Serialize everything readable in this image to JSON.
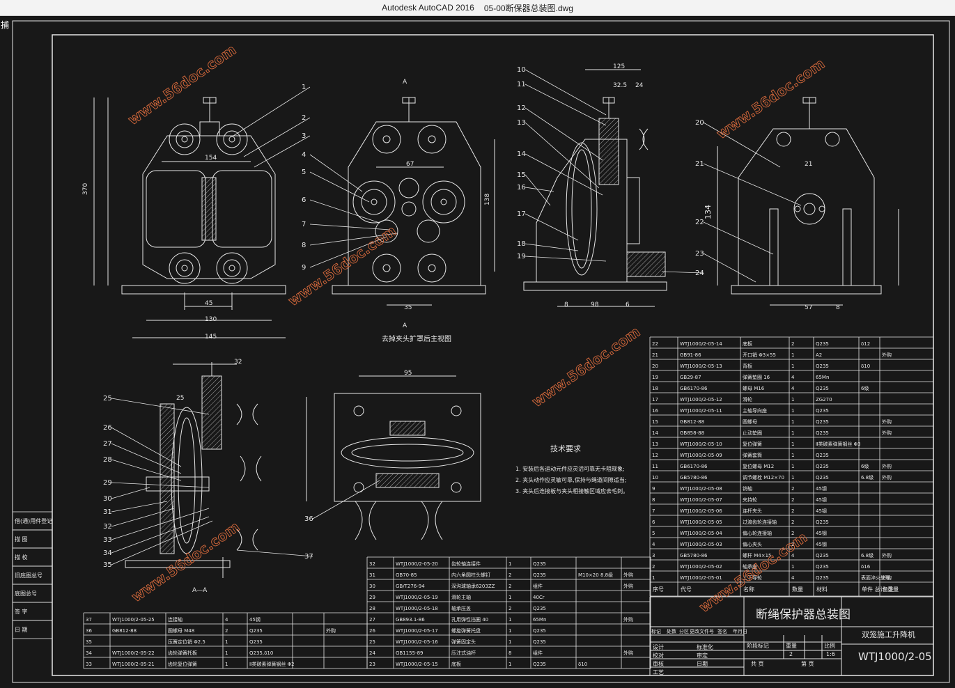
{
  "window": {
    "app_name": "Autodesk AutoCAD 2016",
    "file_name": "05-00断保器总装图.dwg"
  },
  "canvas": {
    "side_glyph": "捕"
  },
  "views": {
    "section_caption": "去掉夹头扩罩后主视图",
    "aa_caption": "A—A",
    "a_marker_top": "A",
    "a_marker_bottom": "A",
    "front_callouts": [
      "1",
      "2",
      "3",
      "4",
      "5",
      "6",
      "7",
      "8",
      "9"
    ],
    "side_callouts": [
      "10",
      "11",
      "12",
      "13",
      "14",
      "15",
      "16",
      "17",
      "18",
      "19"
    ],
    "right_callouts": [
      "20",
      "21",
      "22",
      "23",
      "24"
    ],
    "bottom_callouts": [
      "25",
      "26",
      "27",
      "28",
      "29",
      "30",
      "31",
      "32",
      "33",
      "34",
      "35"
    ],
    "plan_callout": "36",
    "aa_callout": "37",
    "dims_front": [
      "370",
      "145",
      "130",
      "45",
      "154"
    ],
    "dims_side": [
      "125",
      "32.5",
      "24",
      "98",
      "6",
      "8"
    ],
    "dims_right": [
      "134",
      "21",
      "57",
      "8"
    ],
    "dims_section": [
      "67",
      "138",
      "35"
    ],
    "dims_bottom": [
      "32",
      "25",
      "95"
    ]
  },
  "tech_requirements": {
    "heading": "技术要求",
    "items": [
      "1. 安装后各运动元件应灵活可靠无卡阻现象;",
      "2. 夹头动作应灵敏可靠,保持与绳道间隙适当;",
      "3. 夹头后连接板与夹头相接触区域应去毛刺。"
    ]
  },
  "bom_right": {
    "rows": [
      [
        "22",
        "WTJ1000/2-05-14",
        "底板",
        "2",
        "Q235",
        "δ12",
        ""
      ],
      [
        "21",
        "GB91-86",
        "开口销 Φ3×55",
        "1",
        "A2",
        "",
        "外购"
      ],
      [
        "20",
        "WTJ1000/2-05-13",
        "背板",
        "1",
        "Q235",
        "δ10",
        ""
      ],
      [
        "19",
        "GB29-87",
        "弹簧垫圈 16",
        "4",
        "65Mn",
        "",
        ""
      ],
      [
        "18",
        "GB6170-86",
        "螺母 M16",
        "4",
        "Q235",
        "6级",
        ""
      ],
      [
        "17",
        "WTJ1000/2-05-12",
        "滑轮",
        "1",
        "ZG270",
        "",
        ""
      ],
      [
        "16",
        "WTJ1000/2-05-11",
        "主轴导向座",
        "1",
        "Q235",
        "",
        ""
      ],
      [
        "15",
        "GB812-88",
        "圆螺母",
        "1",
        "Q235",
        "",
        "外购"
      ],
      [
        "14",
        "GB858-88",
        "止动垫圈",
        "1",
        "Q235",
        "",
        "外购"
      ],
      [
        "13",
        "WTJ1000/2-05-10",
        "复位弹簧",
        "1",
        "Ⅱ类碳素弹簧钢丝 Φ3",
        "",
        ""
      ],
      [
        "12",
        "WTJ1000/2-05-09",
        "弹簧套筒",
        "1",
        "Q235",
        "",
        ""
      ],
      [
        "11",
        "GB6170-86",
        "复位螺母 M12",
        "1",
        "Q235",
        "6级",
        "外购"
      ],
      [
        "10",
        "GB5780-86",
        "调节螺栓 M12×70",
        "1",
        "Q235",
        "6.8级",
        "外购"
      ],
      [
        "9",
        "WTJ1000/2-05-08",
        "销轴",
        "2",
        "45钢",
        "",
        ""
      ],
      [
        "8",
        "WTJ1000/2-05-07",
        "夹持轮",
        "2",
        "45钢",
        "",
        ""
      ],
      [
        "7",
        "WTJ1000/2-05-06",
        "连杆夹头",
        "2",
        "45钢",
        "",
        ""
      ],
      [
        "6",
        "WTJ1000/2-05-05",
        "过渡齿轮连接轴",
        "2",
        "Q235",
        "",
        ""
      ],
      [
        "5",
        "WTJ1000/2-05-04",
        "偏心轮连接轴",
        "2",
        "45钢",
        "",
        ""
      ],
      [
        "4",
        "WTJ1000/2-05-03",
        "偏心夹头",
        "2",
        "45钢",
        "",
        ""
      ],
      [
        "3",
        "GB5780-86",
        "螺杆 M4×15",
        "4",
        "Q235",
        "6.8级",
        "外购"
      ],
      [
        "2",
        "WTJ1000/2-05-02",
        "轴承座",
        "1",
        "Q235",
        "δ16",
        ""
      ],
      [
        "1",
        "WTJ1000/2-05-01",
        "上下导轮",
        "4",
        "Q235",
        "表面淬火处理",
        "外购"
      ]
    ],
    "header": [
      "序号",
      "代号",
      "名称",
      "数量",
      "材料",
      "单件 总计 重量",
      "备注"
    ]
  },
  "bom_mid": {
    "rows": [
      [
        "32",
        "WTJ1000/2-05-20",
        "齿轮轴连接件",
        "1",
        "Q235",
        "",
        ""
      ],
      [
        "31",
        "GB70-85",
        "内六角圆柱头螺钉",
        "2",
        "Q235",
        "M10×20 8.8级",
        "外购"
      ],
      [
        "30",
        "GB/T276-94",
        "深沟球轴承6203ZZ",
        "2",
        "组件",
        "",
        "外购"
      ],
      [
        "29",
        "WTJ1000/2-05-19",
        "滑轮主轴",
        "1",
        "40Cr",
        "",
        ""
      ],
      [
        "28",
        "WTJ1000/2-05-18",
        "轴承压盖",
        "2",
        "Q235",
        "",
        ""
      ],
      [
        "27",
        "GB893.1-86",
        "孔用弹性挡圈 40",
        "1",
        "65Mn",
        "",
        "外购"
      ],
      [
        "26",
        "WTJ1000/2-05-17",
        "螺旋弹簧托盘",
        "1",
        "Q235",
        "",
        ""
      ],
      [
        "25",
        "WTJ1000/2-05-16",
        "弹簧固定头",
        "1",
        "Q235",
        "",
        ""
      ],
      [
        "24",
        "GB1155-89",
        "压注式油杯",
        "8",
        "组件",
        "",
        "外购"
      ],
      [
        "23",
        "WTJ1000/2-05-15",
        "底板",
        "1",
        "Q235",
        "δ10",
        ""
      ]
    ]
  },
  "bom_left": {
    "rows": [
      [
        "37",
        "WTJ1000/2-05-25",
        "连接轴",
        "4",
        "45钢",
        "",
        ""
      ],
      [
        "36",
        "GB812-88",
        "圆螺母 M48",
        "2",
        "Q235",
        "",
        "外购"
      ],
      [
        "35",
        "",
        "压簧定位销 Φ2.5",
        "1",
        "Q235",
        "",
        ""
      ],
      [
        "34",
        "WTJ1000/2-05-22",
        "齿轮弹簧托板",
        "1",
        "Q235,δ10",
        "",
        ""
      ],
      [
        "33",
        "WTJ1000/2-05-21",
        "齿轮复位弹簧",
        "1",
        "Ⅱ类碳素弹簧钢丝 Φ2",
        "",
        ""
      ]
    ]
  },
  "side_stamp": {
    "rows": [
      "借(通)用件登记",
      "描 图",
      "描 校",
      "旧底图总号",
      "底图总号",
      "签 字",
      "日 期"
    ]
  },
  "title_block": {
    "drawing_title": "断绳保护器总装图",
    "product_name": "双笼施工升降机",
    "drawing_no": "WTJ1000/2-05",
    "stage_label": "阶段标记",
    "weight_label": "重量",
    "scale_label": "比例",
    "qty_value": "2",
    "scale_value": "1:6",
    "sheet_label": "共 页",
    "sheet_of": "第 页",
    "roles": [
      "设计",
      "校对",
      "审核",
      "工艺"
    ],
    "role_extra": [
      "标准化",
      "审定",
      "日期"
    ],
    "revision_header": [
      "标记",
      "处数",
      "分区",
      "更改文件号",
      "签名",
      "年月日"
    ]
  },
  "watermarks": {
    "text": "www.56doc.com"
  }
}
